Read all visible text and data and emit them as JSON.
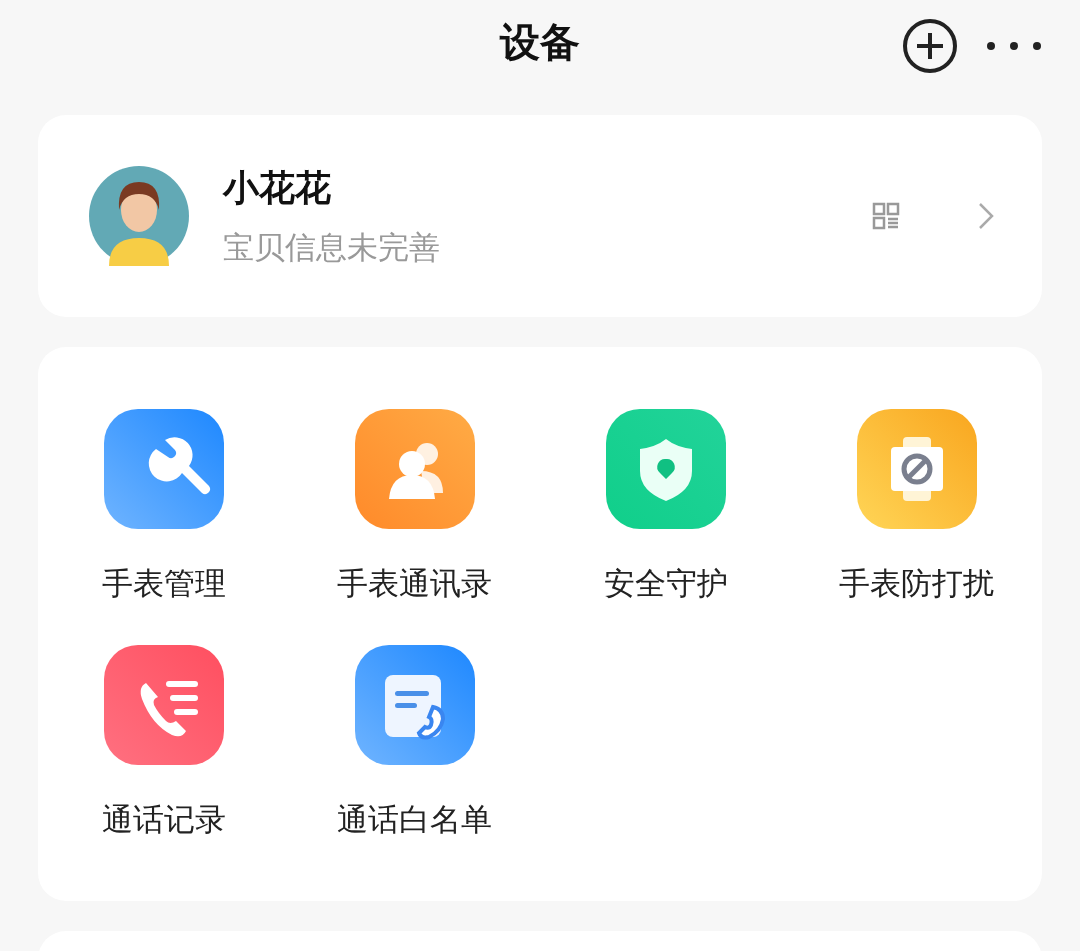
{
  "header": {
    "title": "设备"
  },
  "profile": {
    "name": "小花花",
    "subtitle": "宝贝信息未完善"
  },
  "features": [
    {
      "kind": "wrench",
      "label": "手表管理"
    },
    {
      "kind": "contacts",
      "label": "手表通讯录"
    },
    {
      "kind": "shield",
      "label": "安全守护"
    },
    {
      "kind": "watch",
      "label": "手表防打扰"
    },
    {
      "kind": "calllog",
      "label": "通话记录"
    },
    {
      "kind": "whitelist",
      "label": "通话白名单"
    }
  ]
}
